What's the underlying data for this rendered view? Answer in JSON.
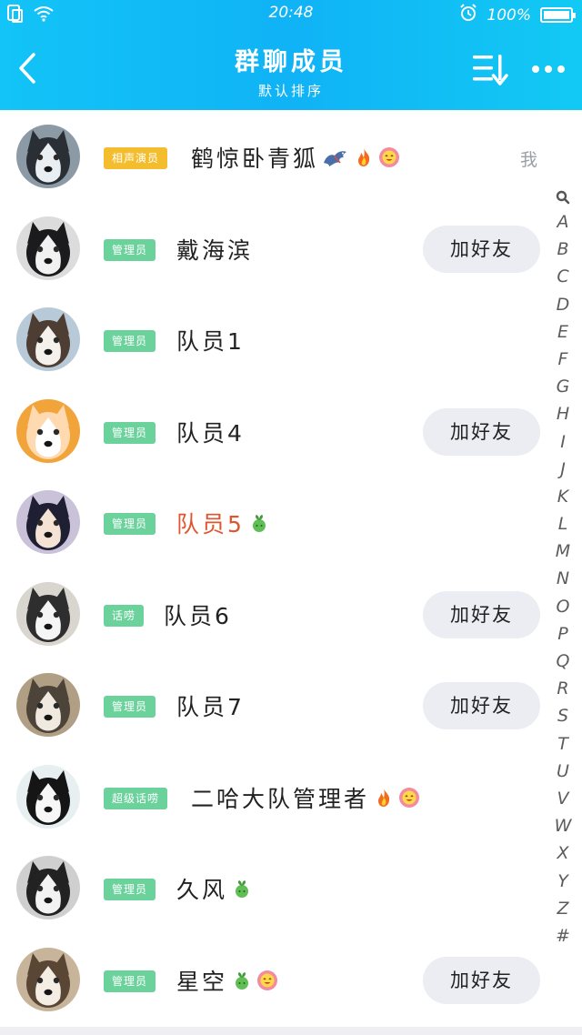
{
  "status_bar": {
    "time": "20:48",
    "battery": "100%"
  },
  "header": {
    "title": "群聊成员",
    "subtitle": "默认排序"
  },
  "me_label": "我",
  "add_friend_label": "加好友",
  "colors": {
    "header": "#12b6f6",
    "badge_green": "#6bd29c",
    "badge_yellow": "#f4bd2d",
    "name_red": "#e2542d"
  },
  "members": [
    {
      "name": "鹤惊卧青狐",
      "role": "相声演员",
      "emojis": [
        "dragon-icon",
        "fire-icon",
        "smiley-flower-icon"
      ],
      "is_me": true
    },
    {
      "name": "戴海滨",
      "role": "管理员",
      "emojis": [],
      "add_friend": true
    },
    {
      "name": "队员1",
      "role": "管理员",
      "emojis": []
    },
    {
      "name": "队员4",
      "role": "管理员",
      "emojis": [],
      "add_friend": true
    },
    {
      "name": "队员5",
      "role": "管理员",
      "emojis": [
        "sprout-icon"
      ]
    },
    {
      "name": "队员6",
      "role": "话唠",
      "emojis": [],
      "add_friend": true
    },
    {
      "name": "队员7",
      "role": "管理员",
      "emojis": [],
      "add_friend": true
    },
    {
      "name": "二哈大队管理者",
      "role": "超级话唠",
      "emojis": [
        "fire-icon",
        "smiley-flower-icon"
      ]
    },
    {
      "name": "久风",
      "role": "管理员",
      "emojis": [
        "sprout-icon"
      ]
    },
    {
      "name": "星空",
      "role": "管理员",
      "emojis": [
        "sprout-icon",
        "smiley-flower-icon"
      ],
      "add_friend": true
    }
  ],
  "index_letters": [
    "A",
    "B",
    "C",
    "D",
    "E",
    "F",
    "G",
    "H",
    "I",
    "J",
    "K",
    "L",
    "M",
    "N",
    "O",
    "P",
    "Q",
    "R",
    "S",
    "T",
    "U",
    "V",
    "W",
    "X",
    "Y",
    "Z",
    "#"
  ]
}
